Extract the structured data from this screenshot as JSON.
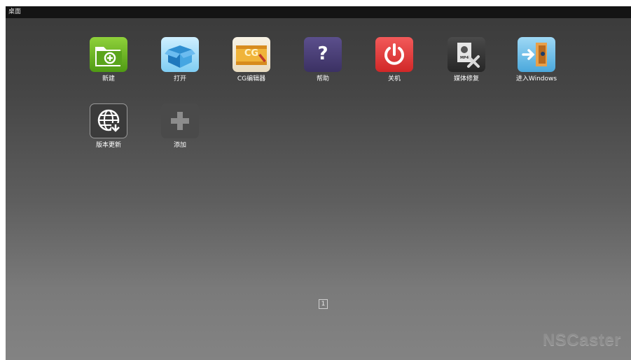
{
  "window": {
    "title": "桌面"
  },
  "apps": [
    {
      "label": "新建",
      "icon": "new-folder-icon"
    },
    {
      "label": "打开",
      "icon": "open-box-icon"
    },
    {
      "label": "CG编辑器",
      "icon": "cg-editor-icon",
      "icon_text": "CG"
    },
    {
      "label": "帮助",
      "icon": "help-icon",
      "icon_text": "?"
    },
    {
      "label": "关机",
      "icon": "power-icon"
    },
    {
      "label": "媒体修复",
      "icon": "media-repair-icon",
      "icon_text": "MP4"
    },
    {
      "label": "进入Windows",
      "icon": "enter-windows-icon"
    }
  ],
  "apps_row2": [
    {
      "label": "版本更新",
      "icon": "version-update-icon"
    },
    {
      "label": "添加",
      "icon": "add-icon"
    }
  ],
  "pager": {
    "current": "1"
  },
  "brand": {
    "text": "NSCaster"
  },
  "colors": {
    "new": "#6ab424",
    "open": "#5ab4e6",
    "cg": "#e8b840",
    "help": "#4a3f78",
    "power": "#e23a3a",
    "media": "#333333",
    "windows": "#5ab4e6"
  }
}
